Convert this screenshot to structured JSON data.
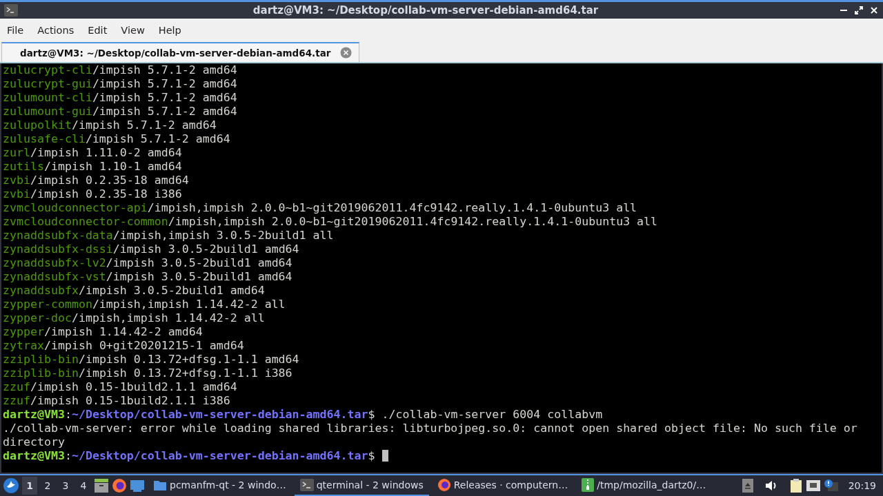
{
  "window": {
    "title": "dartz@VM3: ~/Desktop/collab-vm-server-debian-amd64.tar"
  },
  "menu": [
    "File",
    "Actions",
    "Edit",
    "View",
    "Help"
  ],
  "tabs": [
    {
      "label": "dartz@VM3: ~/Desktop/collab-vm-server-debian-amd64.tar",
      "selected": true
    }
  ],
  "terminal": {
    "lines": [
      {
        "kind": "package",
        "name": "zulucrypt-cli",
        "rest": "/impish 5.7.1-2 amd64"
      },
      {
        "kind": "package",
        "name": "zulucrypt-gui",
        "rest": "/impish 5.7.1-2 amd64"
      },
      {
        "kind": "package",
        "name": "zulumount-cli",
        "rest": "/impish 5.7.1-2 amd64"
      },
      {
        "kind": "package",
        "name": "zulumount-gui",
        "rest": "/impish 5.7.1-2 amd64"
      },
      {
        "kind": "package",
        "name": "zulupolkit",
        "rest": "/impish 5.7.1-2 amd64"
      },
      {
        "kind": "package",
        "name": "zulusafe-cli",
        "rest": "/impish 5.7.1-2 amd64"
      },
      {
        "kind": "package",
        "name": "zurl",
        "rest": "/impish 1.11.0-2 amd64"
      },
      {
        "kind": "package",
        "name": "zutils",
        "rest": "/impish 1.10-1 amd64"
      },
      {
        "kind": "package",
        "name": "zvbi",
        "rest": "/impish 0.2.35-18 amd64"
      },
      {
        "kind": "package",
        "name": "zvbi",
        "rest": "/impish 0.2.35-18 i386"
      },
      {
        "kind": "package",
        "name": "zvmcloudconnector-api",
        "rest": "/impish,impish 2.0.0~b1~git2019062011.4fc9142.really.1.4.1-0ubuntu3 all"
      },
      {
        "kind": "package",
        "name": "zvmcloudconnector-common",
        "rest": "/impish,impish 2.0.0~b1~git2019062011.4fc9142.really.1.4.1-0ubuntu3 all"
      },
      {
        "kind": "package",
        "name": "zynaddsubfx-data",
        "rest": "/impish,impish 3.0.5-2build1 all"
      },
      {
        "kind": "package",
        "name": "zynaddsubfx-dssi",
        "rest": "/impish 3.0.5-2build1 amd64"
      },
      {
        "kind": "package",
        "name": "zynaddsubfx-lv2",
        "rest": "/impish 3.0.5-2build1 amd64"
      },
      {
        "kind": "package",
        "name": "zynaddsubfx-vst",
        "rest": "/impish 3.0.5-2build1 amd64"
      },
      {
        "kind": "package",
        "name": "zynaddsubfx",
        "rest": "/impish 3.0.5-2build1 amd64"
      },
      {
        "kind": "package",
        "name": "zypper-common",
        "rest": "/impish,impish 1.14.42-2 all"
      },
      {
        "kind": "package",
        "name": "zypper-doc",
        "rest": "/impish,impish 1.14.42-2 all"
      },
      {
        "kind": "package",
        "name": "zypper",
        "rest": "/impish 1.14.42-2 amd64"
      },
      {
        "kind": "package",
        "name": "zytrax",
        "rest": "/impish 0+git20201215-1 amd64"
      },
      {
        "kind": "package",
        "name": "zziplib-bin",
        "rest": "/impish 0.13.72+dfsg.1-1.1 amd64"
      },
      {
        "kind": "package",
        "name": "zziplib-bin",
        "rest": "/impish 0.13.72+dfsg.1-1.1 i386"
      },
      {
        "kind": "package",
        "name": "zzuf",
        "rest": "/impish 0.15-1build2.1.1 amd64"
      },
      {
        "kind": "package",
        "name": "zzuf",
        "rest": "/impish 0.15-1build2.1.1 i386"
      },
      {
        "kind": "prompt",
        "user": "dartz@VM3",
        "separator": ":",
        "path": "~/Desktop/collab-vm-server-debian-amd64.tar",
        "rest": "$ ./collab-vm-server 6004 collabvm",
        "cursor": false
      },
      {
        "kind": "output",
        "text": "./collab-vm-server: error while loading shared libraries: libturbojpeg.so.0: cannot open shared object file: No such file or"
      },
      {
        "kind": "output",
        "text": "directory"
      },
      {
        "kind": "prompt",
        "user": "dartz@VM3",
        "separator": ":",
        "path": "~/Desktop/collab-vm-server-debian-amd64.tar",
        "rest": "$ ",
        "cursor": true
      }
    ]
  },
  "taskbar": {
    "desktops": [
      {
        "label": "1",
        "selected": true
      },
      {
        "label": "2",
        "selected": false
      },
      {
        "label": "3",
        "selected": false
      },
      {
        "label": "4",
        "selected": false
      }
    ],
    "tasks": [
      {
        "kind": "folder",
        "label": "pcmanfm-qt - 2 windo…",
        "selected": false
      },
      {
        "kind": "terminal",
        "label": "qterminal - 2 windows",
        "selected": true
      },
      {
        "kind": "firefox",
        "label": "Releases · computern…",
        "selected": false
      },
      {
        "kind": "archive",
        "label": "/tmp/mozilla_dartz0/…",
        "selected": false
      }
    ],
    "clock": "20:19"
  }
}
